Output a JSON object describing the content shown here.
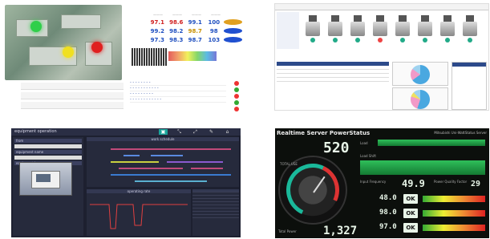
{
  "panelA": {
    "metrics": [
      [
        "97.1",
        "98.6",
        "99.1",
        "100"
      ],
      [
        "99.2",
        "98.2",
        "98.7",
        "98"
      ],
      [
        "97.3",
        "98.3",
        "98.7",
        "103"
      ]
    ],
    "list": [
      "- - - - - - - -",
      "- - - - - - - - - - -",
      "- - - - - - - - -",
      "- - - - - - - - - - - -"
    ]
  },
  "panelB": {},
  "panelC": {
    "title": "equipment operation",
    "top_labels": [
      "from",
      "to",
      "work schedule"
    ],
    "left_labels": [
      "equipment name",
      "equipment ID",
      "equipment image",
      "repair history"
    ],
    "operating_rate_label": "operating rate"
  },
  "panelD": {
    "title": "Realtime Server PowerStatus",
    "subtitle": "Mitsubishi Uni-WattStatus Server",
    "big_value": "520",
    "bottom_value": "1,327",
    "gauge_label": "TOTAL USE",
    "load_label": "Load",
    "load_shift_label": "Load Shift",
    "input_frequency_label": "Input Frequency",
    "input_frequency_value": "49.9",
    "input_frequency_unit": "Hz",
    "power_quality_label": "Power Quality Factor",
    "power_quality_value": "29",
    "ups_value": "48.0",
    "input_value": "98.0",
    "output_value": "97.0",
    "ok_label": "OK",
    "total_power_label": "Total Power",
    "accent": "#1ab89a"
  }
}
